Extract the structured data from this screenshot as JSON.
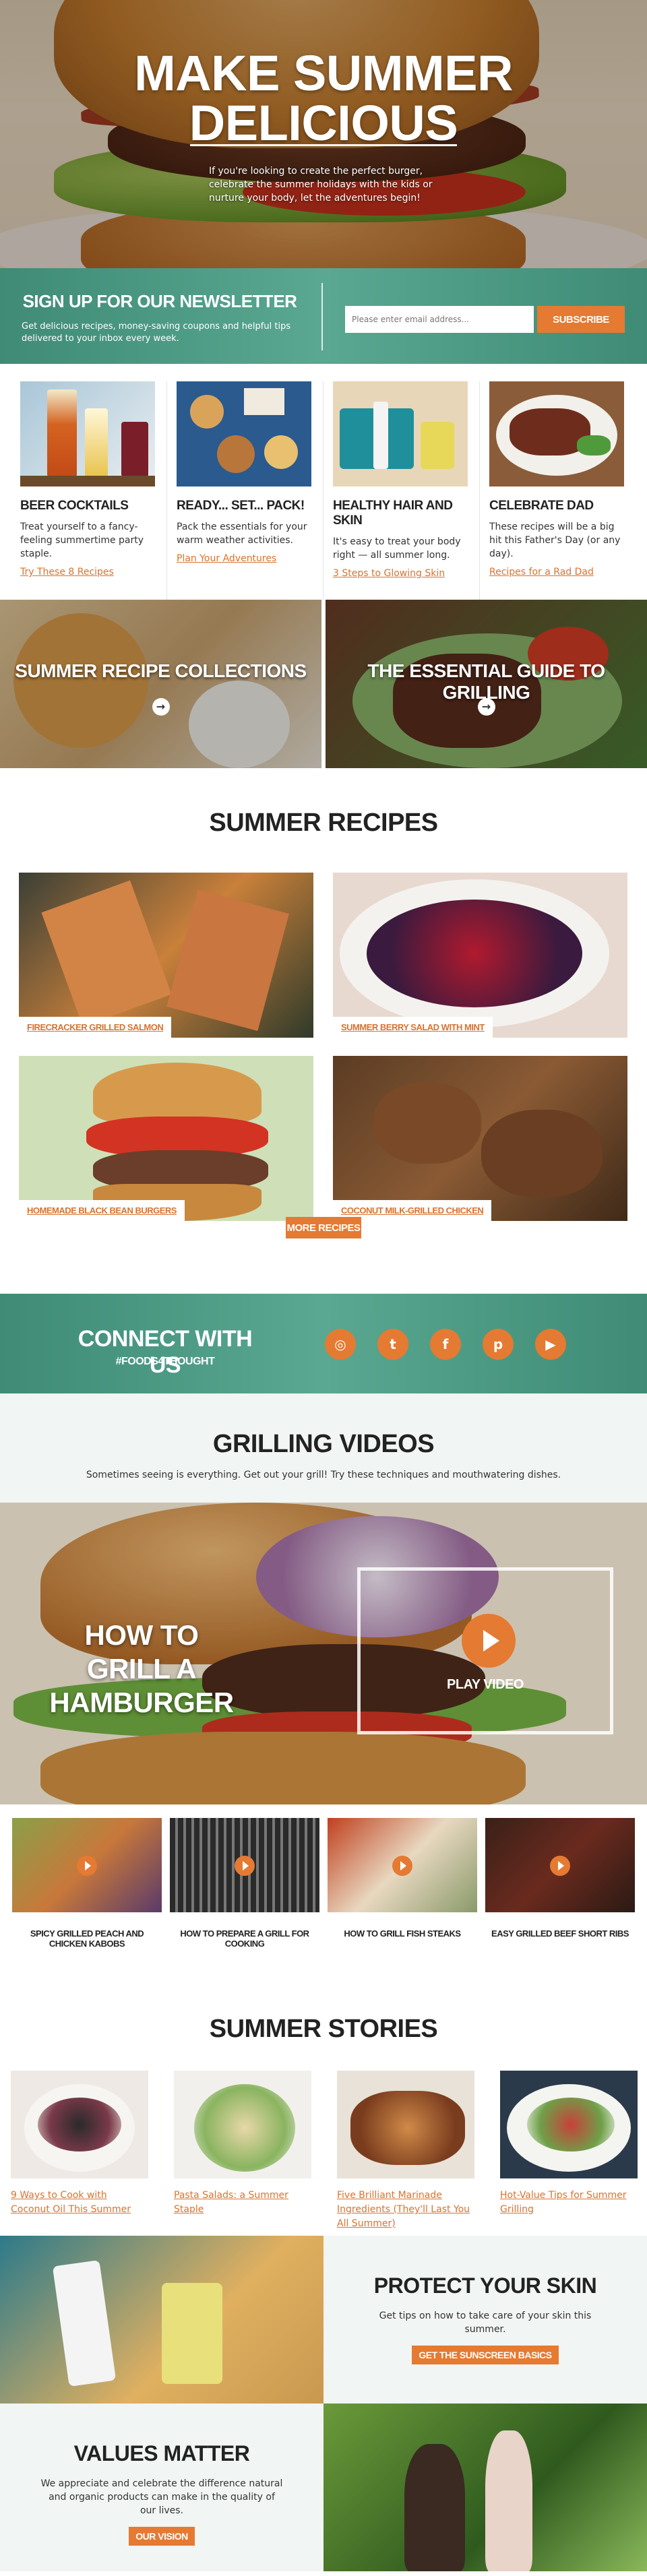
{
  "hero": {
    "title": "MAKE SUMMER DELICIOUS",
    "intro": "If you're looking to create the perfect burger, celebrate the summer holidays with the kids or nurture your body, let the adventures begin!"
  },
  "newsletter": {
    "title": "SIGN UP FOR OUR NEWSLETTER",
    "text": "Get delicious recipes, money-saving coupons and helpful tips delivered to your inbox every week.",
    "email_placeholder": "Please enter email address...",
    "subscribe_label": "SUBSCRIBE"
  },
  "promo_cards": [
    {
      "title": "BEER COCKTAILS",
      "text": "Treat yourself to a fancy-feeling summertime party staple.",
      "link": "Try These 8 Recipes"
    },
    {
      "title": "READY... SET... PACK!",
      "text": "Pack the essentials for your warm weather activities.",
      "link": "Plan Your Adventures"
    },
    {
      "title": "HEALTHY HAIR AND SKIN",
      "text": "It's easy to treat your body right — all summer long.",
      "link": "3 Steps to Glowing Skin"
    },
    {
      "title": "CELEBRATE DAD",
      "text": "These recipes will be a big hit this Father's Day (or any day).",
      "link": "Recipes for a Rad Dad"
    }
  ],
  "collections": [
    {
      "title": "SUMMER RECIPE COLLECTIONS",
      "arrow": "→"
    },
    {
      "title": "THE ESSENTIAL GUIDE TO GRILLING",
      "arrow": "→"
    }
  ],
  "recipes": {
    "title": "SUMMER RECIPES",
    "items": [
      {
        "label": "FIRECRACKER GRILLED SALMON"
      },
      {
        "label": "SUMMER BERRY SALAD WITH MINT"
      },
      {
        "label": "HOMEMADE BLACK BEAN BURGERS"
      },
      {
        "label": "COCONUT MILK-GRILLED CHICKEN"
      }
    ],
    "more_label": "MORE RECIPES"
  },
  "connect": {
    "title": "CONNECT WITH US",
    "hashtag": "#FOODS4THOUGHT",
    "icons": [
      {
        "name": "instagram-icon",
        "glyph": "◎"
      },
      {
        "name": "twitter-icon",
        "glyph": "t"
      },
      {
        "name": "facebook-icon",
        "glyph": "f"
      },
      {
        "name": "pinterest-icon",
        "glyph": "p"
      },
      {
        "name": "youtube-icon",
        "glyph": "▶"
      }
    ]
  },
  "videos": {
    "title": "GRILLING VIDEOS",
    "subtitle": "Sometimes seeing is everything. Get out your grill! Try these techniques and mouthwatering dishes.",
    "feature_title_line1": "HOW TO",
    "feature_title_line2": "GRILL A HAMBURGER",
    "play_label": "PLAY VIDEO",
    "items": [
      {
        "title": "SPICY GRILLED PEACH AND CHICKEN KABOBS"
      },
      {
        "title": "HOW TO PREPARE A GRILL FOR COOKING"
      },
      {
        "title": "HOW TO GRILL FISH STEAKS"
      },
      {
        "title": "EASY GRILLED BEEF SHORT RIBS"
      }
    ]
  },
  "stories": {
    "title": "SUMMER STORIES",
    "items": [
      {
        "link": "9 Ways to Cook with Coconut Oil This Summer"
      },
      {
        "link": "Pasta Salads: a Summer Staple"
      },
      {
        "link": "Five Brilliant Marinade Ingredients (They'll Last You All Summer)"
      },
      {
        "link": "Hot-Value Tips for Summer Grilling"
      }
    ]
  },
  "skin": {
    "title": "PROTECT YOUR SKIN",
    "text": "Get tips on how to take care of your skin this summer.",
    "button": "GET THE SUNSCREEN BASICS"
  },
  "values": {
    "title": "VALUES MATTER",
    "text": "We appreciate and celebrate the difference natural and organic products can make in the quality of our lives.",
    "button": "OUR VISION"
  },
  "colors": {
    "accent": "#e57a32",
    "teal": "#4a9a82",
    "link": "#d9722e"
  }
}
